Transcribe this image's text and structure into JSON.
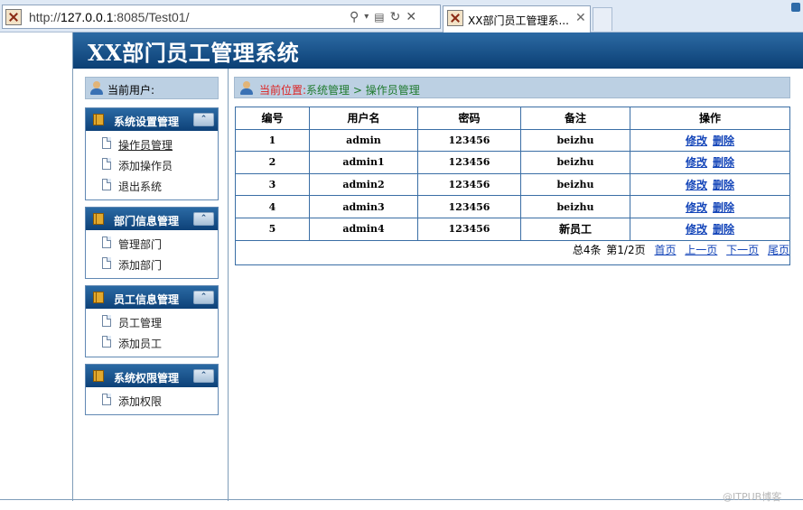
{
  "browser": {
    "url_prefix": "http://",
    "url_host": "127.0.0.1",
    "url_rest": ":8085/Test01/",
    "tab_title": "XX部门员工管理系...",
    "tab_close": "✕"
  },
  "header": {
    "title": "XX部门员工管理系统"
  },
  "user_bar": {
    "label": "当前用户:"
  },
  "panels": [
    {
      "title": "系统设置管理",
      "collapse": "⌃",
      "items": [
        "操作员管理",
        "添加操作员",
        "退出系统"
      ]
    },
    {
      "title": "部门信息管理",
      "collapse": "⌃",
      "items": [
        "管理部门",
        "添加部门"
      ]
    },
    {
      "title": "员工信息管理",
      "collapse": "⌃",
      "items": [
        "员工管理",
        "添加员工"
      ]
    },
    {
      "title": "系统权限管理",
      "collapse": "⌃",
      "items": [
        "添加权限"
      ]
    }
  ],
  "breadcrumb": {
    "key": "当前位置:",
    "path": "系统管理 > 操作员管理"
  },
  "table": {
    "headers": [
      "编号",
      "用户名",
      "密码",
      "备注",
      "操作"
    ],
    "rows": [
      {
        "id": "1",
        "username": "admin",
        "password": "123456",
        "remark": "beizhu"
      },
      {
        "id": "2",
        "username": "admin1",
        "password": "123456",
        "remark": "beizhu"
      },
      {
        "id": "3",
        "username": "admin2",
        "password": "123456",
        "remark": "beizhu"
      },
      {
        "id": "4",
        "username": "admin3",
        "password": "123456",
        "remark": "beizhu"
      },
      {
        "id": "5",
        "username": "admin4",
        "password": "123456",
        "remark": "新员工"
      }
    ],
    "edit_label": "修改",
    "delete_label": "删除"
  },
  "pager": {
    "total": "总4条",
    "page": "第1/2页",
    "first": "首页",
    "prev": "上一页",
    "next": "下一页",
    "last": "尾页"
  },
  "watermark": "@ITPUB博客"
}
